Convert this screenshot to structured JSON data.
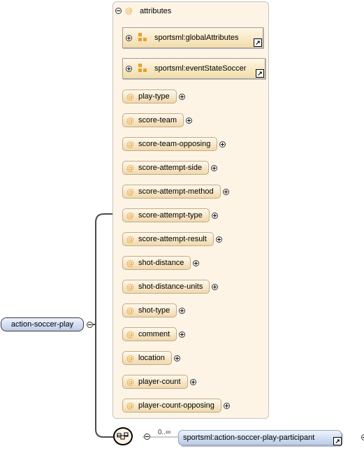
{
  "element": {
    "name": "action-soccer-play"
  },
  "attributes_group": {
    "label": "attributes",
    "attribute_groups": [
      {
        "name": "sportsml:globalAttributes"
      },
      {
        "name": "sportsml:eventStateSoccer"
      }
    ],
    "attributes": [
      {
        "name": "play-type"
      },
      {
        "name": "score-team"
      },
      {
        "name": "score-team-opposing"
      },
      {
        "name": "score-attempt-side"
      },
      {
        "name": "score-attempt-method"
      },
      {
        "name": "score-attempt-type"
      },
      {
        "name": "score-attempt-result"
      },
      {
        "name": "shot-distance"
      },
      {
        "name": "shot-distance-units"
      },
      {
        "name": "shot-type"
      },
      {
        "name": "comment"
      },
      {
        "name": "location"
      },
      {
        "name": "player-count"
      },
      {
        "name": "player-count-opposing"
      }
    ]
  },
  "child": {
    "name": "sportsml:action-soccer-play-participant",
    "occurrence": "0..∞"
  },
  "icons": {
    "attribute": "@",
    "collapse": "minus-circle",
    "expand": "plus-circle",
    "reference": "link-arrow",
    "compositor": "sequence"
  },
  "colors": {
    "group_bg": "#fdf4e5",
    "attribute_marker": "#e7a43b",
    "element_fill": "#c8d6ef"
  }
}
